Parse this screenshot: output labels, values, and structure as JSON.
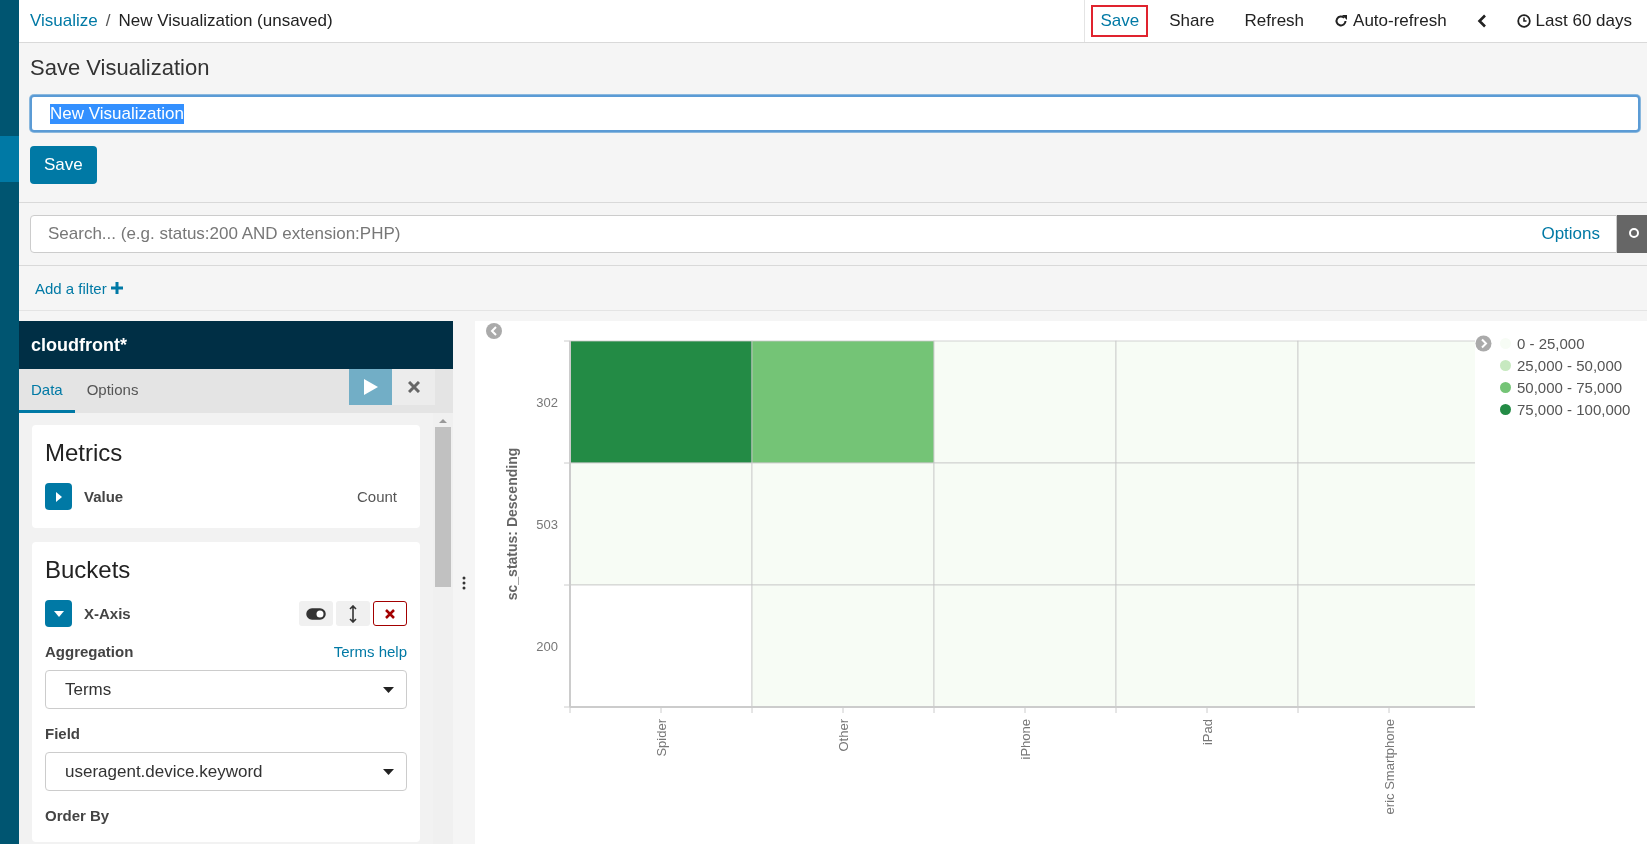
{
  "top_bar": {
    "breadcrumbs": [
      {
        "label": "Visualize",
        "kind": "link"
      },
      {
        "label": "New Visualization (unsaved)",
        "kind": "current"
      }
    ],
    "separator": "/",
    "menu": [
      {
        "label": "Save",
        "kind": "text",
        "highlighted": true
      },
      {
        "label": "Share",
        "kind": "text",
        "highlighted": false
      },
      {
        "label": "Refresh",
        "kind": "text",
        "highlighted": false
      },
      {
        "label": "Auto-refresh",
        "kind": "refresh",
        "highlighted": false
      },
      {
        "kind": "prev",
        "highlighted": false
      },
      {
        "label": "Last 60 days",
        "kind": "clock",
        "highlighted": false
      }
    ]
  },
  "save_panel": {
    "title": "Save Visualization",
    "name_field": {
      "value": "New Visualization",
      "selected": true
    },
    "button": "Save"
  },
  "search": {
    "placeholder": "Search... (e.g. status:200 AND extension:PHP)",
    "options": "Options"
  },
  "filter": {
    "label": "Add a filter"
  },
  "sidebar": {
    "index_pattern": "cloudfront*",
    "tabs": [
      {
        "label": "Data",
        "selected": true
      },
      {
        "label": "Options",
        "selected": false
      }
    ],
    "metrics": {
      "title": "Metrics",
      "items": [
        {
          "label": "Value",
          "type": "Count",
          "expanded": false
        }
      ]
    },
    "buckets": {
      "title": "Buckets",
      "items": [
        {
          "label": "X-Axis",
          "expanded": true,
          "enabled": true,
          "aggregation_label": "Aggregation",
          "help": "Terms help",
          "aggregation": "Terms",
          "field_label": "Field",
          "field": "useragent.device.keyword",
          "order_label": "Order By"
        }
      ]
    }
  },
  "chart": {
    "y_title": "sc_status: Descending",
    "columns": [
      "Spider",
      "Other",
      "iPhone",
      "iPad",
      "eric Smartphone"
    ],
    "rows": [
      {
        "label": "302",
        "cells": [
          {
            "color": "#238b45"
          },
          {
            "color": "#74c476"
          },
          {
            "color": "#f7fcf5"
          },
          {
            "color": "#f7fcf5"
          },
          {
            "color": "#f7fcf5"
          }
        ]
      },
      {
        "label": "503",
        "cells": [
          {
            "color": "#f7fcf5"
          },
          {
            "color": "#f7fcf5"
          },
          {
            "color": "#f7fcf5"
          },
          {
            "color": "#f7fcf5"
          },
          {
            "color": "#f7fcf5"
          }
        ]
      },
      {
        "label": "200",
        "cells": [
          {
            "color": "#ffffff"
          },
          {
            "color": "#f7fcf5"
          },
          {
            "color": "#f7fcf5"
          },
          {
            "color": "#f7fcf5"
          },
          {
            "color": "#f7fcf5"
          }
        ]
      }
    ],
    "legend": [
      {
        "label": "0 - 25,000",
        "color": "#f7fcf5"
      },
      {
        "label": "25,000 - 50,000",
        "color": "#c7e9c0"
      },
      {
        "label": "50,000 - 75,000",
        "color": "#74c476"
      },
      {
        "label": "75,000 - 100,000",
        "color": "#238b45"
      }
    ]
  }
}
